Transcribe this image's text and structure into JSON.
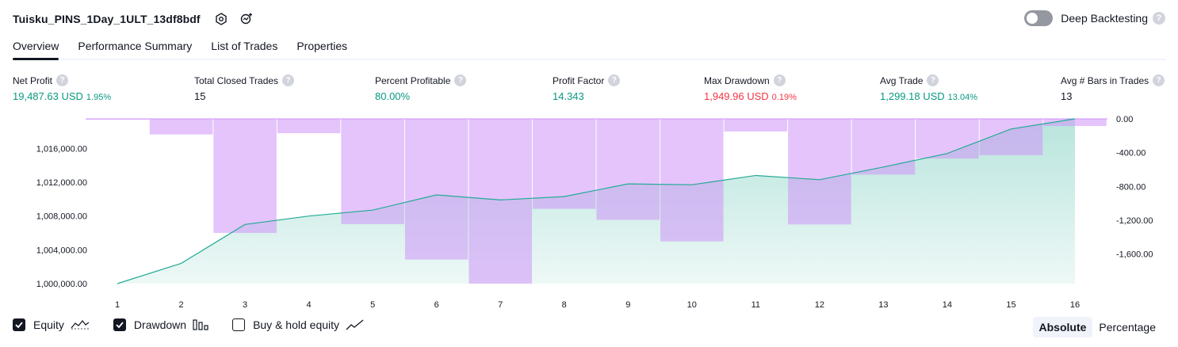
{
  "header": {
    "title": "Tuisku_PINS_1Day_1ULT_13df8bdf",
    "deep_backtesting_label": "Deep Backtesting",
    "deep_backtesting_enabled": false
  },
  "tabs": [
    {
      "label": "Overview",
      "active": true
    },
    {
      "label": "Performance Summary",
      "active": false
    },
    {
      "label": "List of Trades",
      "active": false
    },
    {
      "label": "Properties",
      "active": false
    }
  ],
  "metrics": {
    "net_profit": {
      "label": "Net Profit",
      "value": "19,487.63 USD",
      "pct": "1.95%"
    },
    "total_closed_trades": {
      "label": "Total Closed Trades",
      "value": "15"
    },
    "percent_profitable": {
      "label": "Percent Profitable",
      "value": "80.00%"
    },
    "profit_factor": {
      "label": "Profit Factor",
      "value": "14.343"
    },
    "max_drawdown": {
      "label": "Max Drawdown",
      "value": "1,949.96 USD",
      "pct": "0.19%"
    },
    "avg_trade": {
      "label": "Avg Trade",
      "value": "1,299.18 USD",
      "pct": "13.04%"
    },
    "avg_bars": {
      "label": "Avg # Bars in Trades",
      "value": "13"
    }
  },
  "chart_data": {
    "type": "line+bar",
    "x": [
      1,
      2,
      3,
      4,
      5,
      6,
      7,
      8,
      9,
      10,
      11,
      12,
      13,
      14,
      15,
      16
    ],
    "series": [
      {
        "name": "Equity",
        "type": "area",
        "axis": "left",
        "values": [
          1000000,
          1002400,
          1007000,
          1008000,
          1008700,
          1010500,
          1009900,
          1010300,
          1011800,
          1011700,
          1012800,
          1012300,
          1013800,
          1015400,
          1018300,
          1019500
        ]
      },
      {
        "name": "Drawdown",
        "type": "bar",
        "axis": "right",
        "values": [
          -10,
          -185,
          -1350,
          -170,
          -1245,
          -1665,
          -1950,
          -1065,
          -1195,
          -1450,
          -150,
          -1250,
          -660,
          -470,
          -430,
          -85
        ]
      }
    ],
    "left_axis": {
      "ylim": [
        1000000,
        1019500
      ],
      "ticks": [
        "1,000,000.00",
        "1,004,000.00",
        "1,008,000.00",
        "1,012,000.00",
        "1,016,000.00"
      ],
      "tick_values": [
        1000000,
        1004000,
        1008000,
        1012000,
        1016000
      ]
    },
    "right_axis": {
      "ylim": [
        -1950,
        0
      ],
      "ticks": [
        "0.00",
        "-400.00",
        "-800.00",
        "-1,200.00",
        "-1,600.00"
      ],
      "tick_values": [
        0,
        -400,
        -800,
        -1200,
        -1600
      ]
    },
    "x_ticks": [
      "1",
      "2",
      "3",
      "4",
      "5",
      "6",
      "7",
      "8",
      "9",
      "10",
      "11",
      "12",
      "13",
      "14",
      "15",
      "16"
    ],
    "colors": {
      "equity_line": "#22ab94",
      "equity_fill": "#22ab94",
      "drawdown": "#ce93f8"
    }
  },
  "legend": {
    "equity": {
      "label": "Equity",
      "checked": true,
      "icon": "equity-line-icon"
    },
    "drawdown": {
      "label": "Drawdown",
      "checked": true,
      "icon": "drawdown-bars-icon"
    },
    "buy_hold": {
      "label": "Buy & hold equity",
      "checked": false,
      "icon": "buy-hold-line-icon"
    }
  },
  "modes": [
    {
      "label": "Absolute",
      "active": true
    },
    {
      "label": "Percentage",
      "active": false
    }
  ]
}
